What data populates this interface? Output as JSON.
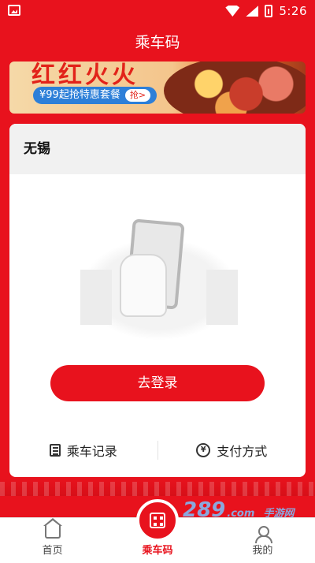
{
  "status_bar": {
    "time": "5:26"
  },
  "header": {
    "title": "乘车码"
  },
  "banner": {
    "headline": "红红火火",
    "promo": "¥99起抢特惠套餐",
    "grab": "抢>"
  },
  "card": {
    "city": "无锡",
    "login_button": "去登录",
    "ride_records": "乘车记录",
    "payment_method": "支付方式"
  },
  "nav": {
    "items": [
      {
        "label": "首页",
        "icon": "home-icon"
      },
      {
        "label": "乘车码",
        "icon": "qr-code-icon",
        "active": true
      },
      {
        "label": "我的",
        "icon": "user-icon"
      }
    ]
  },
  "watermark": {
    "brand": "289",
    "domain": ".com",
    "subtext": "手游网"
  },
  "colors": {
    "primary": "#e8121d",
    "background": "#ffffff",
    "nav_text": "#444444"
  }
}
